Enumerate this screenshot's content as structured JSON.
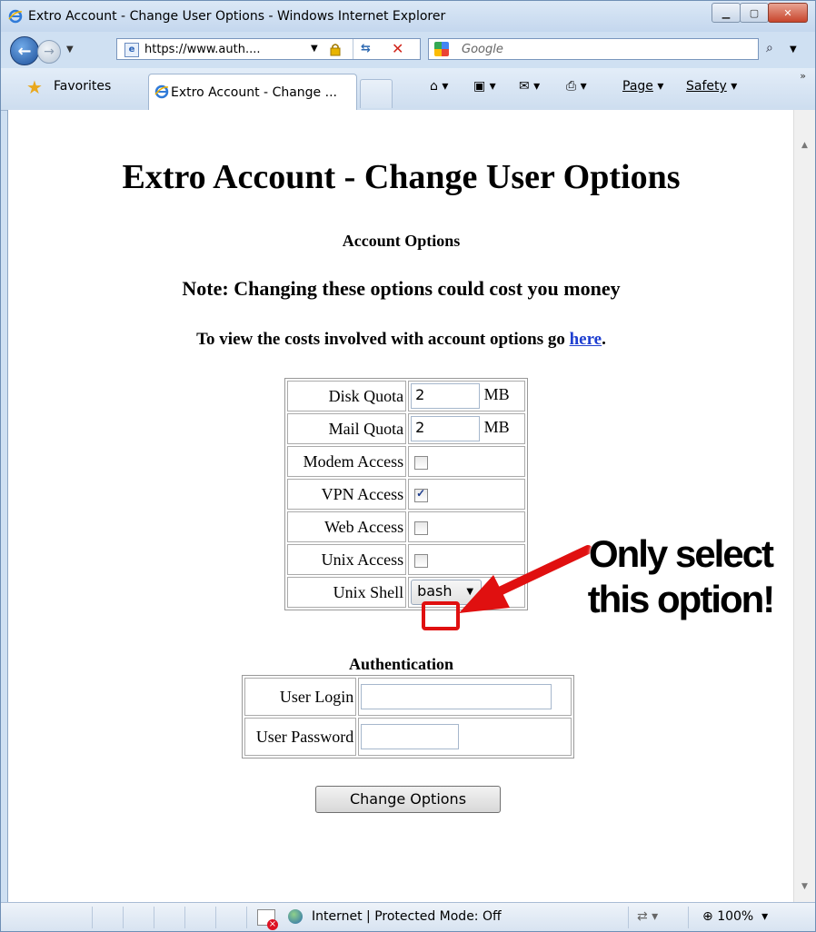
{
  "window": {
    "title": "Extro Account - Change User Options - Windows Internet Explorer"
  },
  "address_bar": {
    "url": "https://www.auth....",
    "search_placeholder": "Google"
  },
  "favorites_bar": {
    "favorites_label": "Favorites",
    "tab_label": "Extro Account - Change ...",
    "page_menu": "Page",
    "safety_menu": "Safety"
  },
  "page": {
    "title": "Extro Account - Change User Options",
    "section_account": "Account Options",
    "note": "Note: Changing these options could cost you money",
    "costs_text": "To view the costs involved with account options go",
    "costs_link": "here",
    "costs_end": "."
  },
  "options": {
    "disk_quota_label": "Disk Quota",
    "disk_quota_value": "2",
    "disk_quota_unit": "MB",
    "mail_quota_label": "Mail Quota",
    "mail_quota_value": "2",
    "mail_quota_unit": "MB",
    "modem_label": "Modem Access",
    "modem_checked": false,
    "vpn_label": "VPN Access",
    "vpn_checked": true,
    "web_label": "Web Access",
    "web_checked": false,
    "unix_label": "Unix Access",
    "unix_checked": false,
    "shell_label": "Unix Shell",
    "shell_value": "bash"
  },
  "authentication": {
    "heading": "Authentication",
    "login_label": "User Login",
    "login_value": "",
    "password_label": "User Password",
    "password_value": ""
  },
  "submit_label": "Change Options",
  "annotation": {
    "line1": "Only select",
    "line2": "this option!",
    "color": "#e01010"
  },
  "status_bar": {
    "zone_text": "Internet | Protected Mode: Off",
    "zoom": "100%"
  }
}
